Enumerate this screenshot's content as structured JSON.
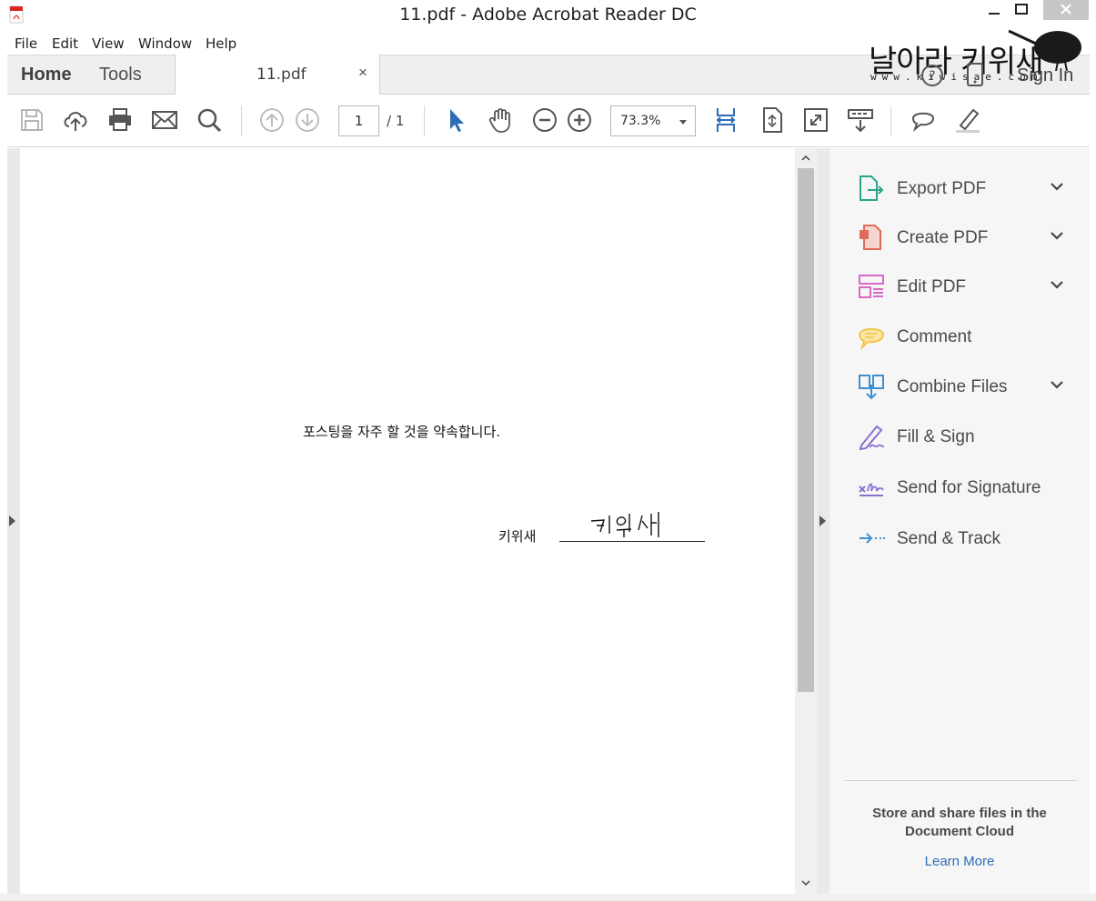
{
  "window": {
    "title": "11.pdf - Adobe Acrobat Reader DC"
  },
  "menu": {
    "items": [
      "File",
      "Edit",
      "View",
      "Window",
      "Help"
    ]
  },
  "tabs": {
    "home": "Home",
    "tools": "Tools",
    "document": "11.pdf",
    "close": "×"
  },
  "watermark": {
    "title": "날아라 키위새",
    "url": "www.kiwisae.com"
  },
  "account": {
    "sign_in": "Sign In"
  },
  "toolbar": {
    "icons": [
      "save-icon",
      "upload-cloud-icon",
      "print-icon",
      "email-icon",
      "search-icon",
      "prev-page-icon",
      "next-page-icon",
      "select-cursor-icon",
      "hand-tool-icon",
      "zoom-out-icon",
      "zoom-in-icon",
      "fit-page-icon",
      "rotate-icon",
      "fullscreen-icon",
      "scrolling-mode-icon",
      "comment-icon",
      "highlight-icon"
    ],
    "page_current": "1",
    "page_total": "/ 1",
    "zoom": "73.3%"
  },
  "document": {
    "body_text": "포스팅을 자주 할 것을 약속합니다.",
    "signature_label": "키위새",
    "signature_text": "키위새"
  },
  "right_pane": {
    "items": [
      {
        "label": "Export PDF",
        "icon": "export-pdf-icon",
        "expandable": true,
        "color": "#2aa58a"
      },
      {
        "label": "Create PDF",
        "icon": "create-pdf-icon",
        "expandable": true,
        "color": "#e06b5b"
      },
      {
        "label": "Edit PDF",
        "icon": "edit-pdf-icon",
        "expandable": true,
        "color": "#d966c9"
      },
      {
        "label": "Comment",
        "icon": "comment-icon",
        "expandable": false,
        "color": "#f2c64a"
      },
      {
        "label": "Combine Files",
        "icon": "combine-files-icon",
        "expandable": true,
        "color": "#3e8fd6"
      },
      {
        "label": "Fill & Sign",
        "icon": "fill-sign-icon",
        "expandable": false,
        "color": "#8a6fd1"
      },
      {
        "label": "Send for Signature",
        "icon": "send-signature-icon",
        "expandable": false,
        "color": "#8a6fd1"
      },
      {
        "label": "Send & Track",
        "icon": "send-track-icon",
        "expandable": false,
        "color": "#3e8fd6"
      }
    ],
    "promo": "Store and share files in the Document Cloud",
    "learn_more": "Learn More"
  }
}
